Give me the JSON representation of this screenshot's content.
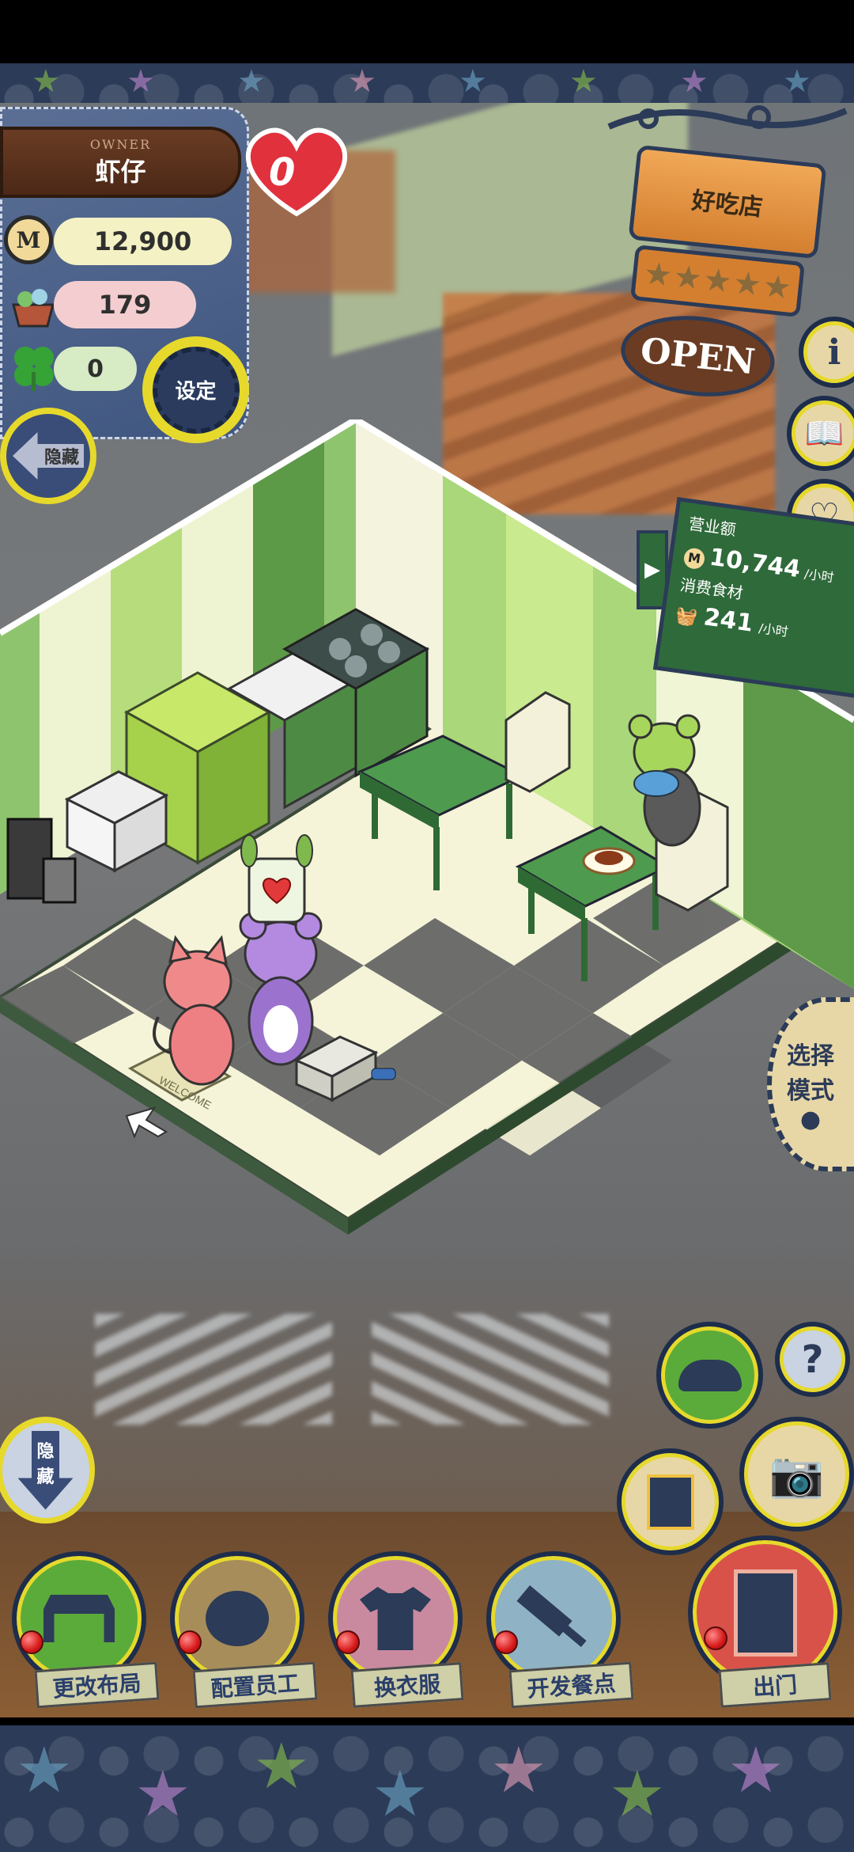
{
  "owner": {
    "caption": "OWNER",
    "name": "虾仔",
    "money": "12,900",
    "ingredients": "179",
    "clovers": "0",
    "settings_label": "设定",
    "hide_label": "隐藏",
    "hearts": "0"
  },
  "shop": {
    "name": "好吃店",
    "rating_stars": 5,
    "open_sign": "OPEN"
  },
  "stats": {
    "revenue_label": "营业额",
    "revenue_value": "10,744",
    "revenue_unit": "/小时",
    "consumption_label": "消费食材",
    "consumption_value": "241",
    "consumption_unit": "/小时"
  },
  "scene": {
    "welcome_mat": "WELCOME"
  },
  "side_buttons": {
    "select_mode_line1": "选择",
    "select_mode_line2": "模式",
    "hide_bottom_line1": "隐",
    "hide_bottom_line2": "藏",
    "help": "?"
  },
  "bottom_menu": [
    {
      "label": "更改布局",
      "icon": "table-icon",
      "color": "#5bab3a"
    },
    {
      "label": "配置员工",
      "icon": "bear-face-icon",
      "color": "#a78d5a"
    },
    {
      "label": "换衣服",
      "icon": "shirt-icon",
      "color": "#c98aa0"
    },
    {
      "label": "开发餐点",
      "icon": "knife-icon",
      "color": "#8fb2c4"
    },
    {
      "label": "出门",
      "icon": "door-icon",
      "color": "#d8524a"
    }
  ],
  "colors": {
    "denim": "#4a5f8a",
    "sign_wood": "#e39a4a",
    "green_sign": "#2f6a3a",
    "accent_red": "#e0313d"
  }
}
